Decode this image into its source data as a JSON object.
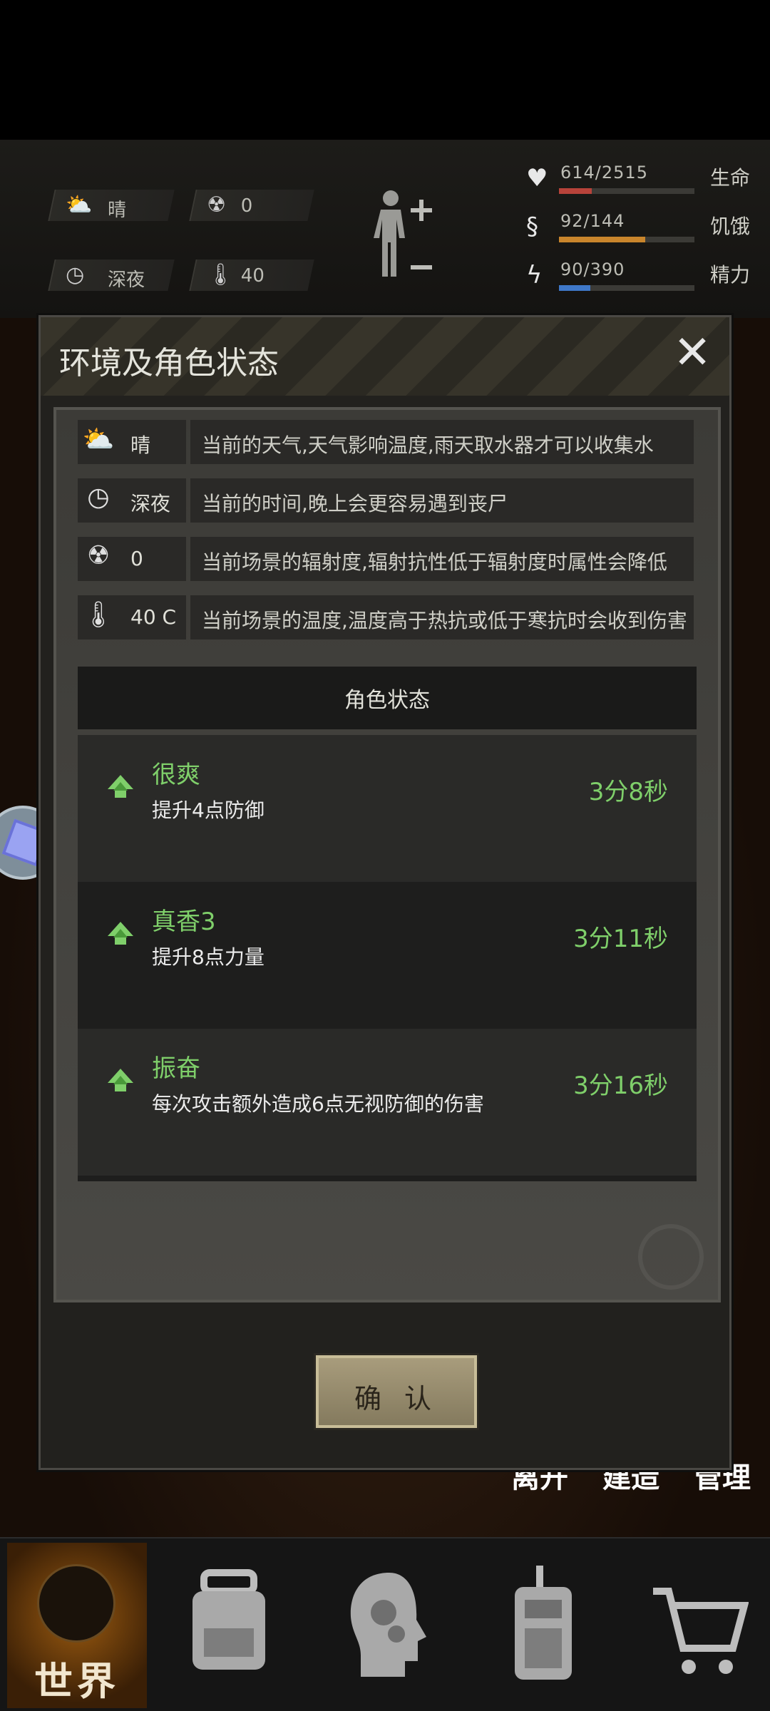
{
  "hud": {
    "weather": "晴",
    "radiation": "0",
    "time_of_day": "深夜",
    "temperature": "40",
    "stats": [
      {
        "icon": "heart-pulse-icon",
        "value": "614/2515",
        "name": "生命",
        "fraction": 0.244,
        "color": "#b8433a"
      },
      {
        "icon": "stomach-icon",
        "value": "92/144",
        "name": "饥饿",
        "fraction": 0.639,
        "color": "#c9852c"
      },
      {
        "icon": "energy-head-icon",
        "value": "90/390",
        "name": "精力",
        "fraction": 0.231,
        "color": "#3f78c8"
      }
    ]
  },
  "dialog": {
    "title": "环境及角色状态",
    "env_rows": [
      {
        "icon": "weather-cloud-sun-icon",
        "value": "晴",
        "desc": "当前的天气,天气影响温度,雨天取水器才可以收集水"
      },
      {
        "icon": "clock-icon",
        "value": "深夜",
        "desc": "当前的时间,晚上会更容易遇到丧尸"
      },
      {
        "icon": "radiation-icon",
        "value": "0",
        "desc": "当前场景的辐射度,辐射抗性低于辐射度时属性会降低"
      },
      {
        "icon": "thermometer-icon",
        "value": "40 C",
        "desc": "当前场景的温度,温度高于热抗或低于寒抗时会收到伤害"
      }
    ],
    "status_header": "角色状态",
    "statuses": [
      {
        "name": "很爽",
        "desc": "提升4点防御",
        "time": "3分8秒"
      },
      {
        "name": "真香3",
        "desc": "提升8点力量",
        "time": "3分11秒"
      },
      {
        "name": "振奋",
        "desc": "每次攻击额外造成6点无视防御的伤害",
        "time": "3分16秒"
      }
    ],
    "confirm_label": "确 认"
  },
  "scene_buttons": [
    "离开",
    "建造",
    "管理"
  ],
  "nav": {
    "world_label": "世界",
    "items": [
      "backpack-icon",
      "skills-head-icon",
      "radio-icon",
      "cart-icon"
    ]
  }
}
